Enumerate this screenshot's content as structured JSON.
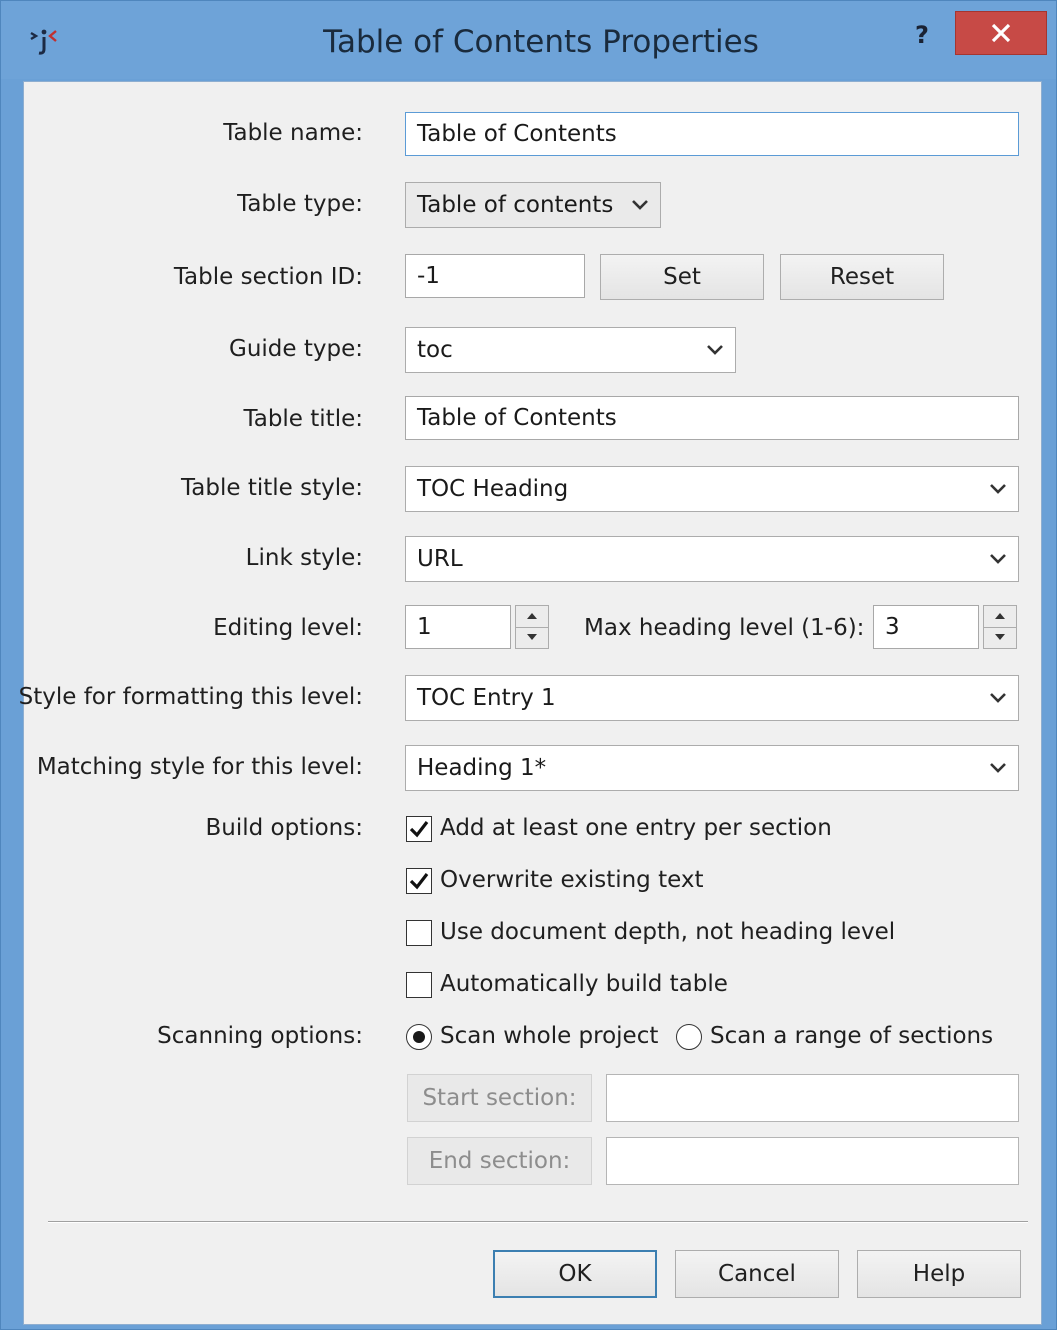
{
  "window": {
    "title": "Table of Contents Properties",
    "help_glyph": "?",
    "icons": {
      "app": "app-logo-icon",
      "close": "close-icon"
    }
  },
  "fields": {
    "table_name": {
      "label": "Table name:",
      "value": "Table of Contents"
    },
    "table_type": {
      "label": "Table type:",
      "value": "Table of contents"
    },
    "table_section_id": {
      "label": "Table section ID:",
      "value": "-1",
      "set_label": "Set",
      "reset_label": "Reset"
    },
    "guide_type": {
      "label": "Guide type:",
      "value": "toc"
    },
    "table_title": {
      "label": "Table title:",
      "value": "Table of Contents"
    },
    "table_title_style": {
      "label": "Table title style:",
      "value": "TOC Heading"
    },
    "link_style": {
      "label": "Link style:",
      "value": "URL"
    },
    "editing_level": {
      "label": "Editing level:",
      "value": "1"
    },
    "max_heading_level": {
      "label": "Max heading level (1-6):",
      "value": "3"
    },
    "style_for_level": {
      "label": "Style for formatting this level:",
      "value": "TOC Entry 1"
    },
    "matching_style": {
      "label": "Matching style for this level:",
      "value": "Heading 1*"
    }
  },
  "build_options": {
    "label": "Build options:",
    "items": [
      {
        "label": "Add at least one entry per section",
        "checked": true
      },
      {
        "label": "Overwrite existing text",
        "checked": true
      },
      {
        "label": "Use document depth, not heading level",
        "checked": false
      },
      {
        "label": "Automatically build table",
        "checked": false
      }
    ]
  },
  "scanning_options": {
    "label": "Scanning options:",
    "scan_whole": {
      "label": "Scan whole project",
      "selected": true
    },
    "scan_range": {
      "label": "Scan a range of sections",
      "selected": false
    },
    "start_section_label": "Start section:",
    "start_section_value": "",
    "end_section_label": "End section:",
    "end_section_value": ""
  },
  "buttons": {
    "ok": "OK",
    "cancel": "Cancel",
    "help": "Help"
  },
  "colors": {
    "titlebar": "#6ea3d8",
    "close": "#c74a46",
    "dialog_bg": "#f0f0f0",
    "focus": "#5b9bd6"
  }
}
